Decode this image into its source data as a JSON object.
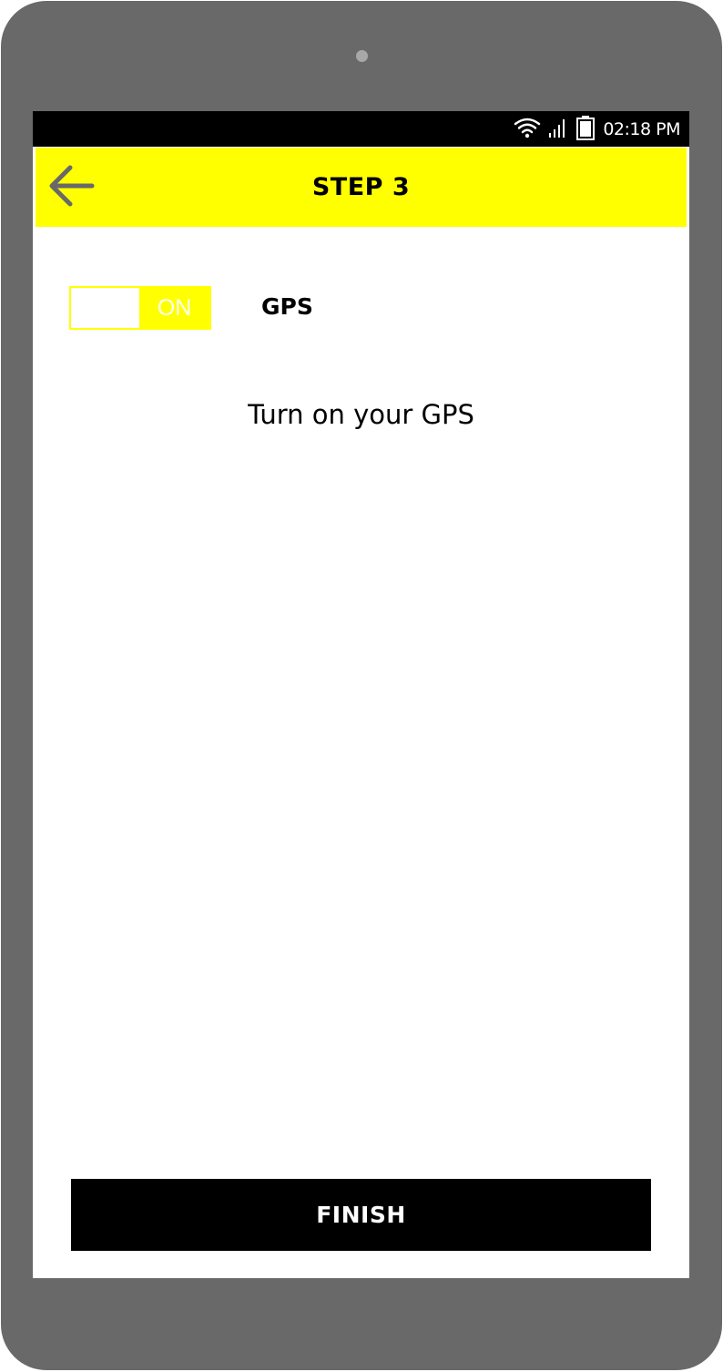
{
  "status_bar": {
    "time": "02:18 PM",
    "icons": [
      "wifi-icon",
      "signal-icon",
      "battery-icon"
    ]
  },
  "app_bar": {
    "back_icon": "arrow-left-icon",
    "title": "STEP 3"
  },
  "gps_toggle": {
    "state_label": "ON",
    "label": "GPS",
    "is_on": true
  },
  "instruction": "Turn on your GPS",
  "finish_button": {
    "label": "FINISH"
  },
  "colors": {
    "accent": "#ffff00",
    "device_frame": "#696969",
    "status_bar": "#000000",
    "button": "#000000"
  }
}
